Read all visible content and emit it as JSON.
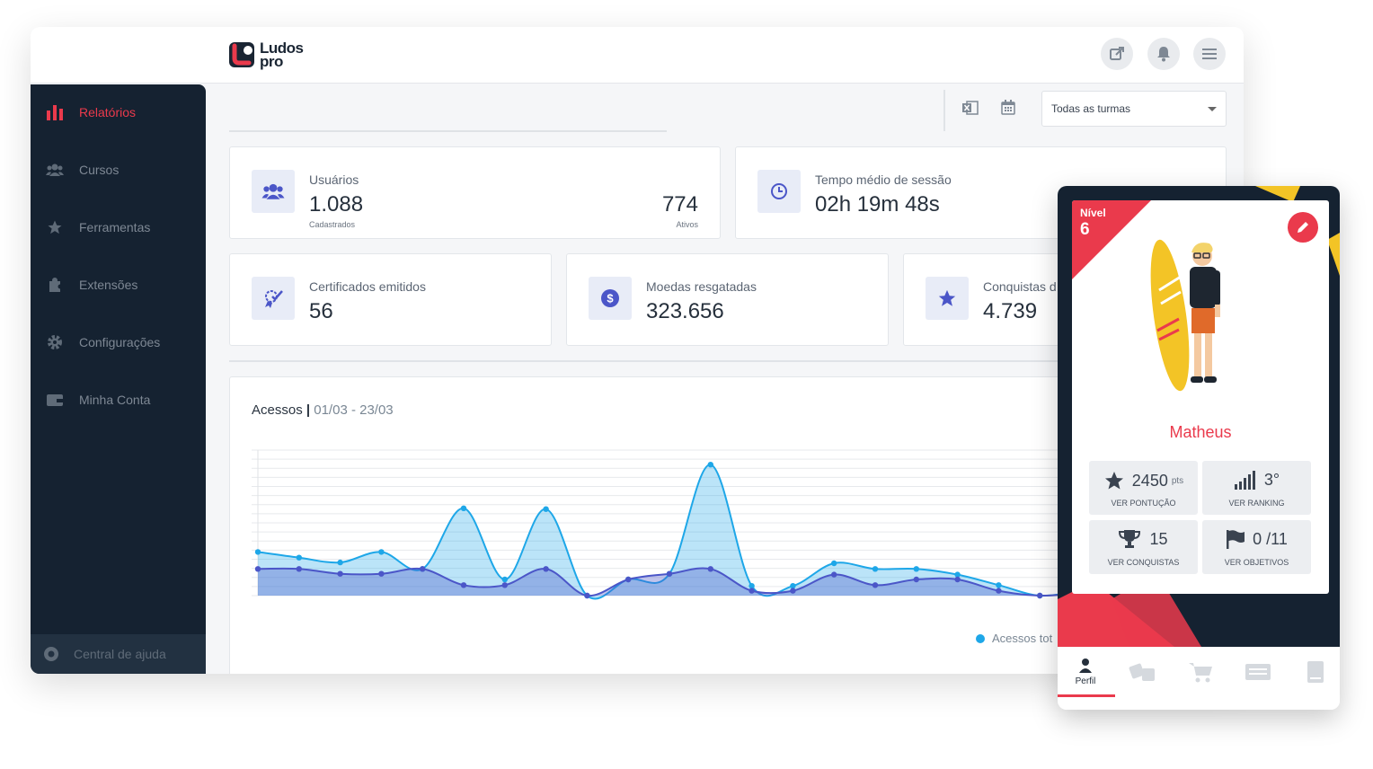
{
  "brand": {
    "line1": "Ludos",
    "line2": "pro"
  },
  "sidebar": {
    "items": [
      {
        "label": "Relatórios",
        "icon": "bar-chart-icon",
        "active": true
      },
      {
        "label": "Cursos",
        "icon": "users-icon"
      },
      {
        "label": "Ferramentas",
        "icon": "star-icon"
      },
      {
        "label": "Extensões",
        "icon": "puzzle-icon"
      },
      {
        "label": "Configurações",
        "icon": "gear-icon"
      },
      {
        "label": "Minha Conta",
        "icon": "wallet-icon"
      }
    ],
    "help": "Central de ajuda"
  },
  "filter": {
    "selected": "Todas as turmas"
  },
  "cards": {
    "usuarios": {
      "label": "Usuários",
      "value": "1.088",
      "sub": "Cadastrados",
      "value2": "774",
      "sub2": "Ativos"
    },
    "tempo": {
      "label": "Tempo médio de sessão",
      "value": "02h 19m 48s"
    },
    "certificados": {
      "label": "Certificados emitidos",
      "value": "56"
    },
    "moedas": {
      "label": "Moedas resgatadas",
      "value": "323.656"
    },
    "conquistas": {
      "label": "Conquistas d",
      "value": "4.739"
    }
  },
  "chart": {
    "title": "Acessos",
    "separator": "|",
    "dates": "01/03 - 23/03",
    "legend": "Acessos tot"
  },
  "chart_data": {
    "type": "area",
    "x": [
      1,
      2,
      3,
      4,
      5,
      6,
      7,
      8,
      9,
      10,
      11,
      12,
      13,
      14,
      15,
      16,
      17,
      18,
      19,
      20,
      21
    ],
    "series": [
      {
        "name": "Acessos tot",
        "values": [
          54,
          47,
          41,
          54,
          33,
          108,
          20,
          107,
          0,
          20,
          27,
          162,
          12,
          12,
          40,
          33,
          33,
          26,
          13,
          0,
          6
        ]
      },
      {
        "name": "",
        "values": [
          33,
          33,
          27,
          27,
          33,
          13,
          13,
          33,
          0,
          20,
          27,
          33,
          6,
          6,
          26,
          13,
          20,
          20,
          6,
          0,
          3
        ]
      }
    ],
    "colors": [
      "#1ea7e8",
      "#4b56c8"
    ],
    "ylim": [
      0,
      180
    ],
    "grid": true
  },
  "phone": {
    "level_label": "Nível",
    "level_value": "6",
    "name": "Matheus",
    "stats": [
      {
        "value": "2450",
        "unit": "pts",
        "label": "VER PONTUÇÃO",
        "icon": "star-icon"
      },
      {
        "value": "3°",
        "unit": "",
        "label": "VER RANKING",
        "icon": "signal-bars-icon"
      },
      {
        "value": "15",
        "unit": "",
        "label": "VER CONQUISTAS",
        "icon": "trophy-icon"
      },
      {
        "value": "0 /11",
        "unit": "",
        "label": "VER OBJETIVOS",
        "icon": "flag-icon"
      }
    ],
    "tabs": [
      {
        "label": "Perfil",
        "icon": "user-icon"
      }
    ]
  }
}
